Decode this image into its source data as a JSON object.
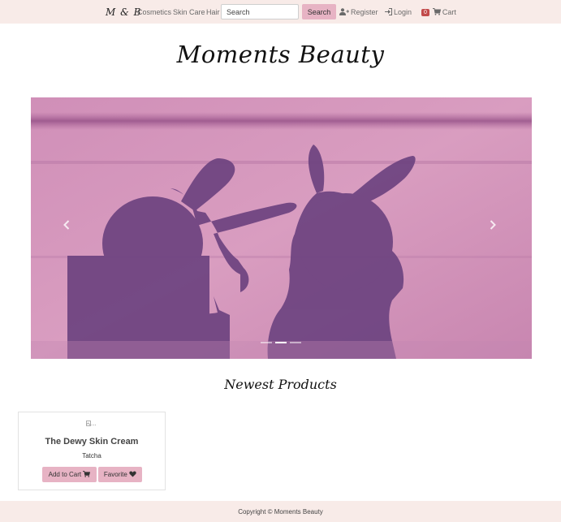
{
  "navbar": {
    "brand": "M & B",
    "links": [
      "Cosmetics",
      "Skin Care",
      "Hair"
    ],
    "search_placeholder": "Search",
    "search_button": "Search",
    "register": "Register",
    "login": "Login",
    "cart_count": "0",
    "cart": "Cart"
  },
  "hero": {
    "title": "Moments Beauty"
  },
  "carousel": {
    "prev_icon": "chevron-left-icon",
    "next_icon": "chevron-right-icon",
    "slide_count": 3,
    "active_slide": 2
  },
  "products": {
    "section_title": "Newest Products",
    "items": [
      {
        "image_alt": "...",
        "name": "The Dewy Skin Cream",
        "brand": "Tatcha",
        "add_to_cart": "Add to Cart",
        "favorite": "Favorite"
      }
    ]
  },
  "footer": {
    "copyright": "Copyright © Moments Beauty"
  },
  "colors": {
    "navbar_bg": "#f8ebe8",
    "button_pink": "#e7b3c4",
    "badge_red": "#c24b4b"
  }
}
